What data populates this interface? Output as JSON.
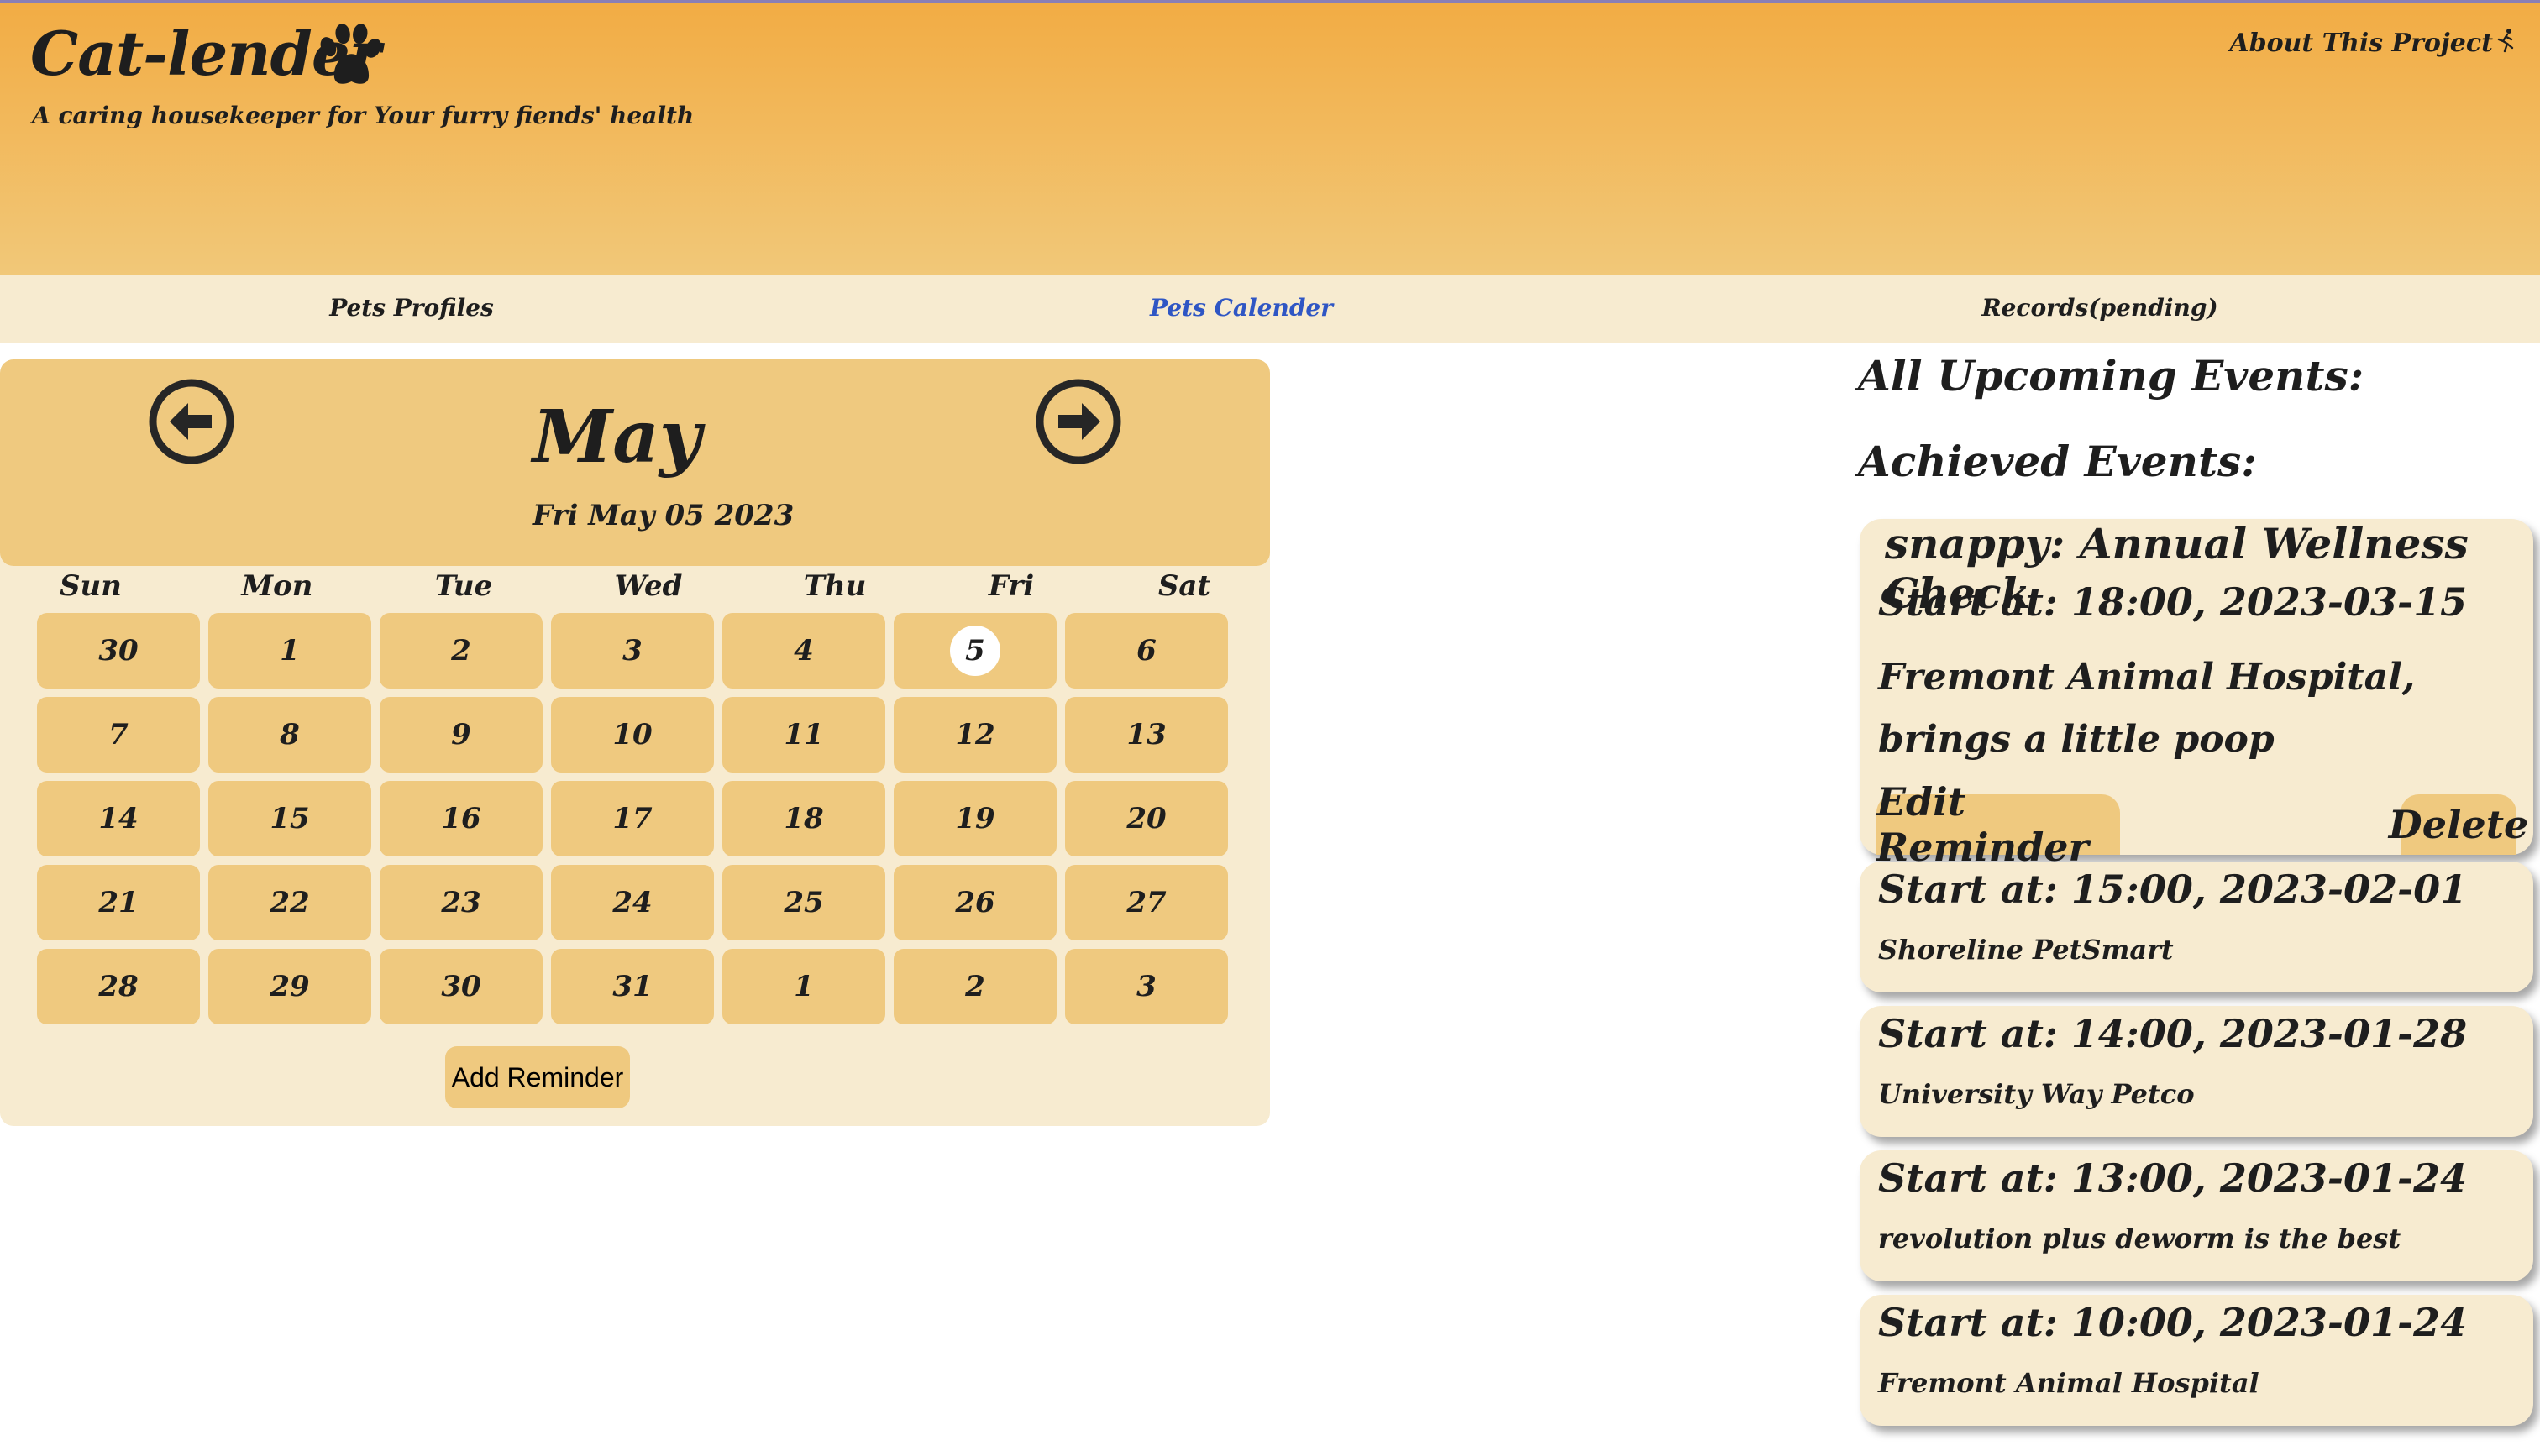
{
  "header": {
    "title": "Cat-lender",
    "tagline": "A caring housekeeper for Your furry fiends' health",
    "about_label": "About This Project",
    "logo_icon": "paw-icon",
    "about_icon": "running-person-icon"
  },
  "nav": {
    "items": [
      {
        "label": "Pets Profiles"
      },
      {
        "label": "Pets Calender",
        "active": true
      },
      {
        "label": "Records(pending)"
      }
    ]
  },
  "calendar": {
    "month": "May",
    "current_date": "Fri May 05 2023",
    "weekdays": [
      "Sun",
      "Mon",
      "Tue",
      "Wed",
      "Thu",
      "Fri",
      "Sat"
    ],
    "weeks": [
      [
        "30",
        "1",
        "2",
        "3",
        "4",
        "5",
        "6"
      ],
      [
        "7",
        "8",
        "9",
        "10",
        "11",
        "12",
        "13"
      ],
      [
        "14",
        "15",
        "16",
        "17",
        "18",
        "19",
        "20"
      ],
      [
        "21",
        "22",
        "23",
        "24",
        "25",
        "26",
        "27"
      ],
      [
        "28",
        "29",
        "30",
        "31",
        "1",
        "2",
        "3"
      ]
    ],
    "today": "5",
    "add_reminder_label": "Add Reminder",
    "prev_icon": "arrow-left-circle-icon",
    "next_icon": "arrow-right-circle-icon"
  },
  "events": {
    "upcoming_title": "All Upcoming Events:",
    "achieved_title": "Achieved Events:",
    "featured": {
      "title": "snappy: Annual Wellness Check",
      "start": "Start at: 18:00, 2023-03-15",
      "description": "Fremont Animal Hospital, brings a little poop",
      "edit_label": "Edit Reminder",
      "delete_label": "Delete"
    },
    "items": [
      {
        "start": "Start at: 15:00, 2023-02-01",
        "location": "Shoreline PetSmart"
      },
      {
        "start": "Start at: 14:00, 2023-01-28",
        "location": "University Way Petco"
      },
      {
        "start": "Start at: 13:00, 2023-01-24",
        "location": "revolution plus deworm is the best"
      },
      {
        "start": "Start at: 10:00, 2023-01-24",
        "location": "Fremont Animal Hospital"
      }
    ]
  },
  "colors": {
    "header_top": "#f2ac44",
    "header_bottom": "#f1c879",
    "panel_bg": "#f7ebd0",
    "cell_bg": "#efc97f",
    "active_link": "#2f56c4"
  }
}
